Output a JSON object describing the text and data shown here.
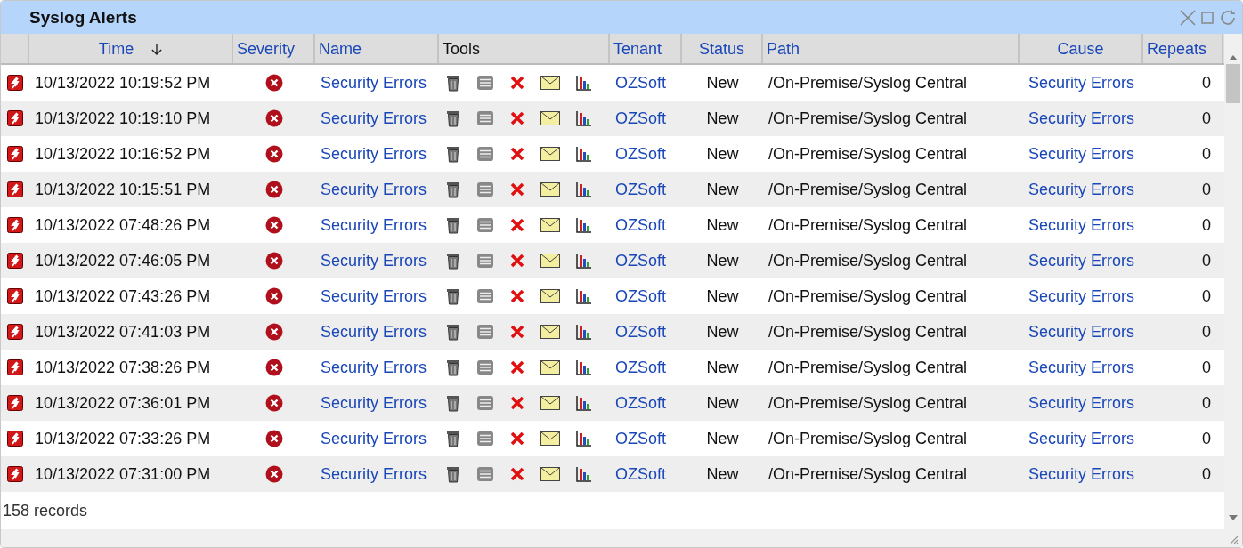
{
  "window": {
    "title": "Syslog Alerts"
  },
  "columns": [
    {
      "label": "Time",
      "sorted": true
    },
    {
      "label": "Severity",
      "sorted": false
    },
    {
      "label": "Name",
      "sorted": false
    },
    {
      "label": "Tools",
      "sorted": false
    },
    {
      "label": "Tenant",
      "sorted": false
    },
    {
      "label": "Status",
      "sorted": false
    },
    {
      "label": "Path",
      "sorted": false
    },
    {
      "label": "Cause",
      "sorted": false
    },
    {
      "label": "Repeats",
      "sorted": false
    }
  ],
  "rows": [
    {
      "time": "10/13/2022 10:19:52 PM",
      "name": "Security Errors",
      "tenant": "OZSoft",
      "status": "New",
      "path": "/On-Premise/Syslog Central",
      "cause": "Security Errors",
      "repeats": "0"
    },
    {
      "time": "10/13/2022 10:19:10 PM",
      "name": "Security Errors",
      "tenant": "OZSoft",
      "status": "New",
      "path": "/On-Premise/Syslog Central",
      "cause": "Security Errors",
      "repeats": "0"
    },
    {
      "time": "10/13/2022 10:16:52 PM",
      "name": "Security Errors",
      "tenant": "OZSoft",
      "status": "New",
      "path": "/On-Premise/Syslog Central",
      "cause": "Security Errors",
      "repeats": "0"
    },
    {
      "time": "10/13/2022 10:15:51 PM",
      "name": "Security Errors",
      "tenant": "OZSoft",
      "status": "New",
      "path": "/On-Premise/Syslog Central",
      "cause": "Security Errors",
      "repeats": "0"
    },
    {
      "time": "10/13/2022 07:48:26 PM",
      "name": "Security Errors",
      "tenant": "OZSoft",
      "status": "New",
      "path": "/On-Premise/Syslog Central",
      "cause": "Security Errors",
      "repeats": "0"
    },
    {
      "time": "10/13/2022 07:46:05 PM",
      "name": "Security Errors",
      "tenant": "OZSoft",
      "status": "New",
      "path": "/On-Premise/Syslog Central",
      "cause": "Security Errors",
      "repeats": "0"
    },
    {
      "time": "10/13/2022 07:43:26 PM",
      "name": "Security Errors",
      "tenant": "OZSoft",
      "status": "New",
      "path": "/On-Premise/Syslog Central",
      "cause": "Security Errors",
      "repeats": "0"
    },
    {
      "time": "10/13/2022 07:41:03 PM",
      "name": "Security Errors",
      "tenant": "OZSoft",
      "status": "New",
      "path": "/On-Premise/Syslog Central",
      "cause": "Security Errors",
      "repeats": "0"
    },
    {
      "time": "10/13/2022 07:38:26 PM",
      "name": "Security Errors",
      "tenant": "OZSoft",
      "status": "New",
      "path": "/On-Premise/Syslog Central",
      "cause": "Security Errors",
      "repeats": "0"
    },
    {
      "time": "10/13/2022 07:36:01 PM",
      "name": "Security Errors",
      "tenant": "OZSoft",
      "status": "New",
      "path": "/On-Premise/Syslog Central",
      "cause": "Security Errors",
      "repeats": "0"
    },
    {
      "time": "10/13/2022 07:33:26 PM",
      "name": "Security Errors",
      "tenant": "OZSoft",
      "status": "New",
      "path": "/On-Premise/Syslog Central",
      "cause": "Security Errors",
      "repeats": "0"
    },
    {
      "time": "10/13/2022 07:31:00 PM",
      "name": "Security Errors",
      "tenant": "OZSoft",
      "status": "New",
      "path": "/On-Premise/Syslog Central",
      "cause": "Security Errors",
      "repeats": "0"
    }
  ],
  "footer": {
    "record_count": "158 records"
  }
}
